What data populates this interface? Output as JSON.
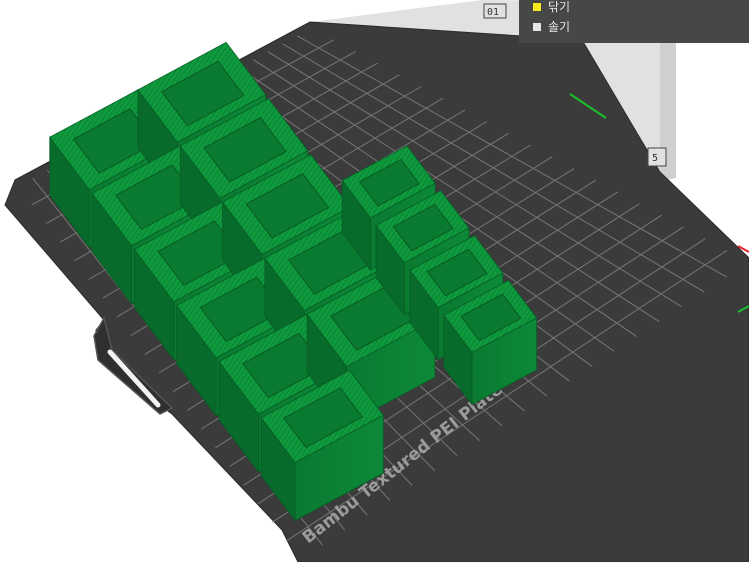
{
  "legend": {
    "items": [
      {
        "label": "닦기",
        "color": "#f5ea1c"
      },
      {
        "label": "솔기",
        "color": "#e6e6e6"
      }
    ]
  },
  "bed": {
    "brand_text": "Bambu Textured PEI Plate",
    "bed_color": "#3b3b3b",
    "grid_color": "#8a8a8a",
    "model_color": "#0d8a3a"
  }
}
